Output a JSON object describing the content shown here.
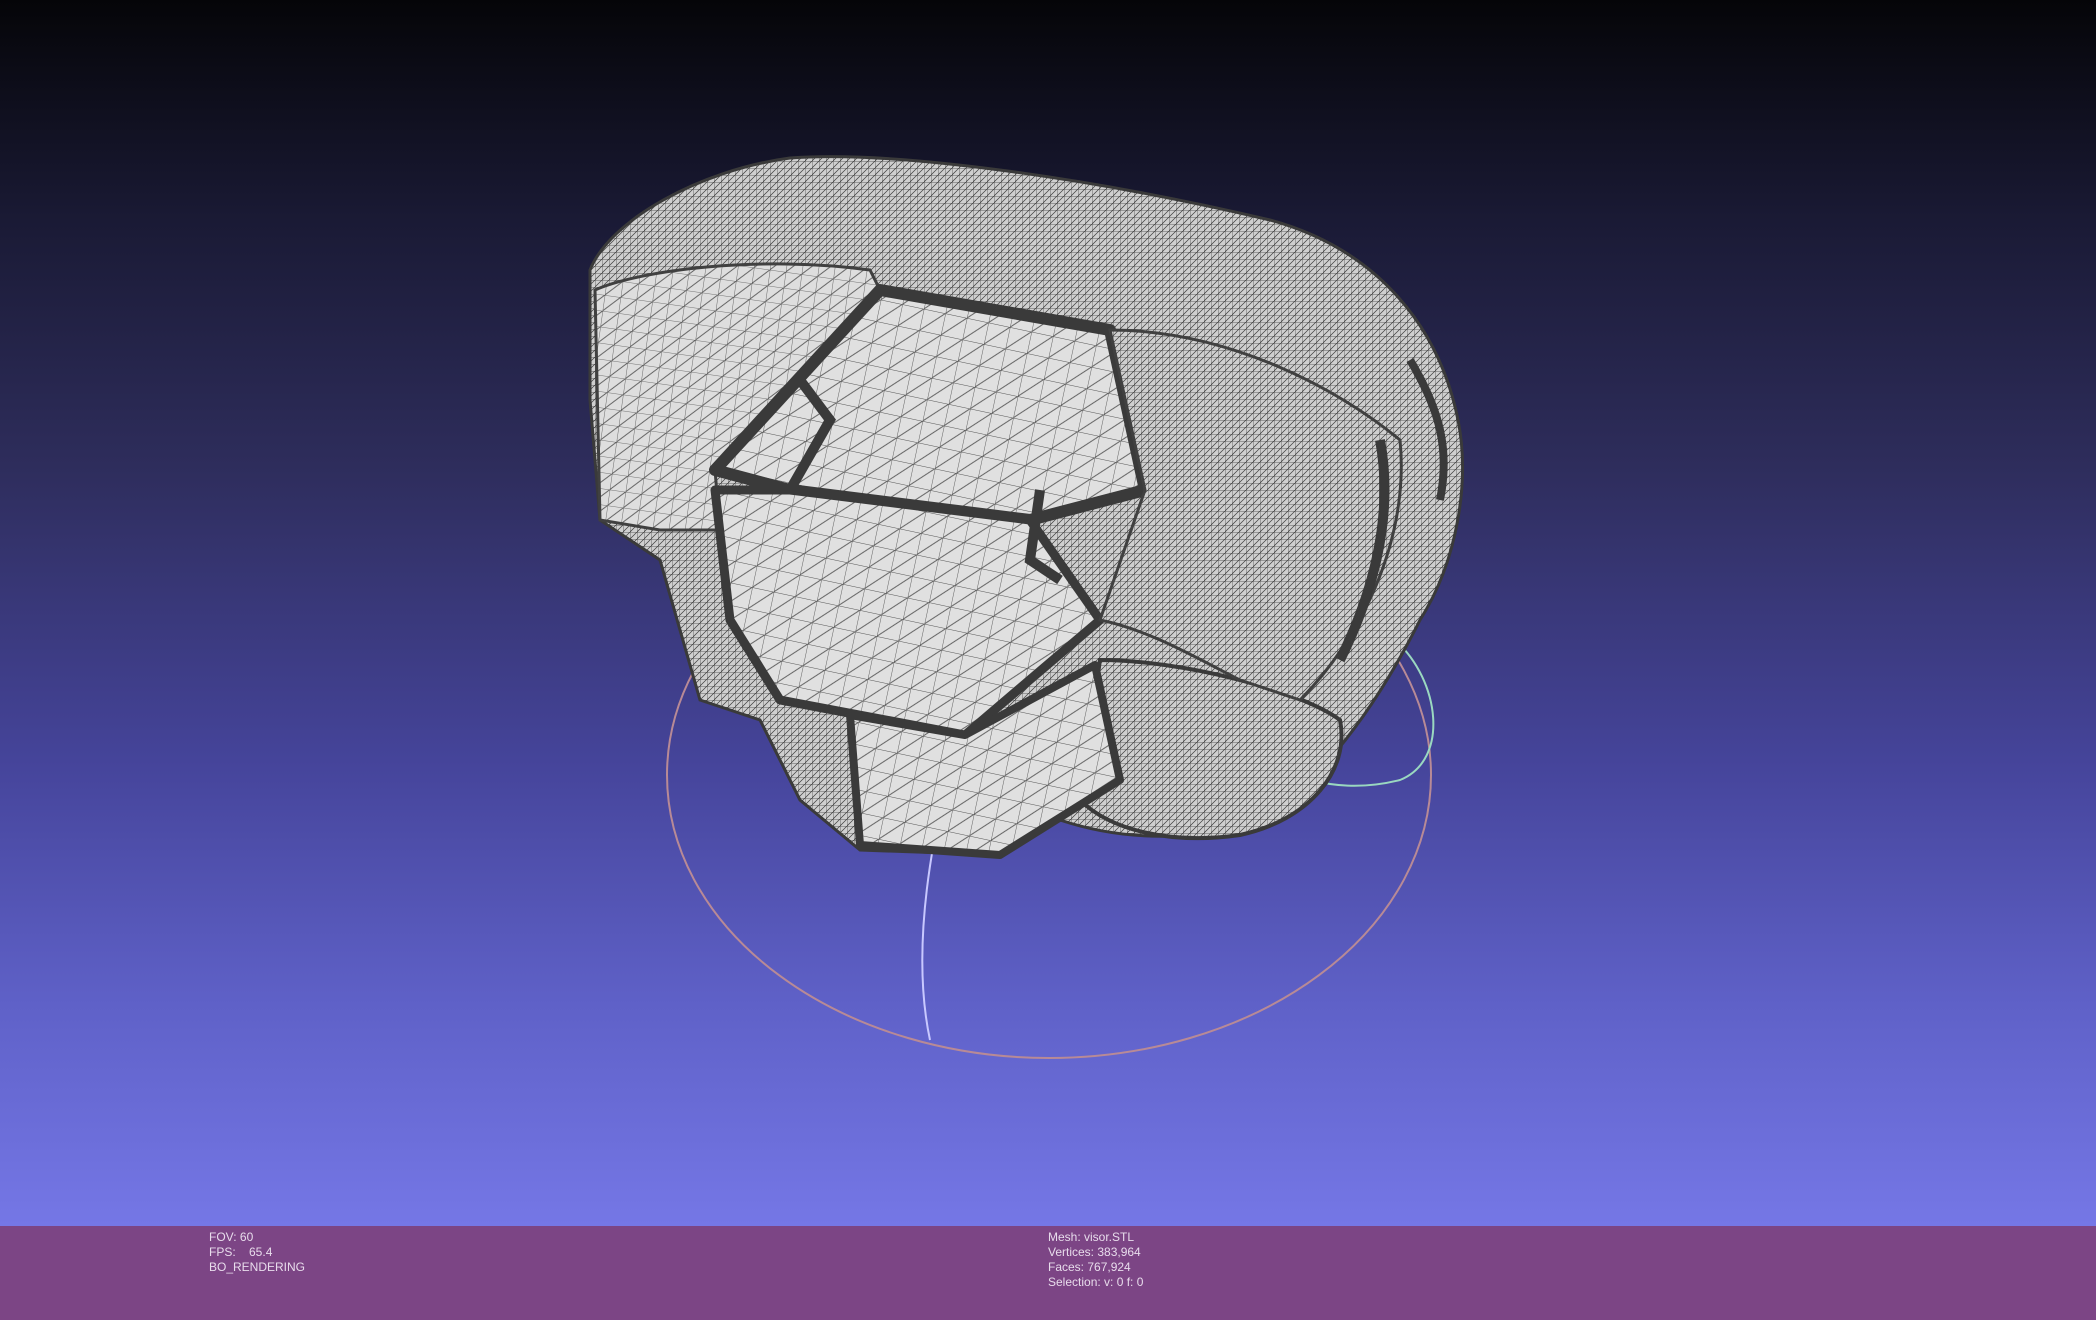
{
  "viewer": {
    "colors": {
      "bg_top": "#050508",
      "bg_bottom": "#7577e6",
      "info_bar": "#7c4585",
      "mesh_face": "#d8d8d8",
      "mesh_edge": "#4a4a4a",
      "trackball_red": "#b88a96",
      "trackball_blue": "#c8c8ff",
      "trackball_green": "#9ad8c0"
    }
  },
  "render_info": {
    "fov": "FOV: 60",
    "fps": "FPS:    65.4",
    "mode": "BO_RENDERING"
  },
  "mesh_info": {
    "mesh": "Mesh: visor.STL",
    "vertices": "Vertices: 383,964",
    "faces": "Faces: 767,924",
    "selection": "Selection: v: 0 f: 0"
  }
}
